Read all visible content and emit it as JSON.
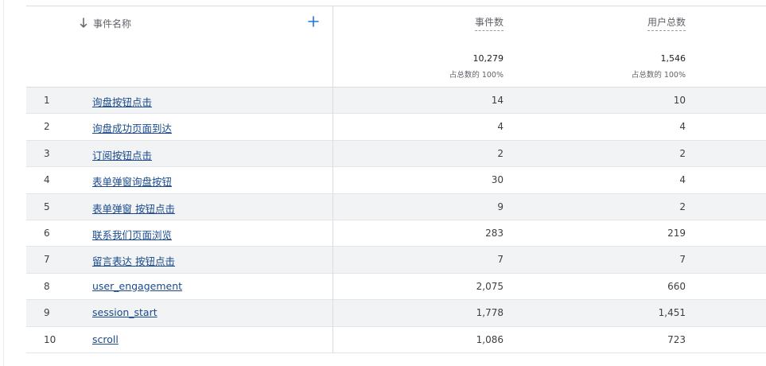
{
  "header": {
    "dimension_title": "事件名称",
    "metrics": [
      {
        "title": "事件数",
        "total": "10,279",
        "pct": "占总数的 100%"
      },
      {
        "title": "用户总数",
        "total": "1,546",
        "pct": "占总数的 100%"
      }
    ]
  },
  "icons": {
    "sort": "arrow-down-icon",
    "add": "plus-icon",
    "accent": "#1a73e8",
    "link": "#1a4a8c"
  },
  "rows": [
    {
      "index": "1",
      "name": "询盘按钮点击",
      "events": "14",
      "users": "10"
    },
    {
      "index": "2",
      "name": "询盘成功页面到达",
      "events": "4",
      "users": "4"
    },
    {
      "index": "3",
      "name": "订阅按钮点击",
      "events": "2",
      "users": "2"
    },
    {
      "index": "4",
      "name": "表单弹窗询盘按钮",
      "events": "30",
      "users": "4"
    },
    {
      "index": "5",
      "name": "表单弹窗 按钮点击",
      "events": "9",
      "users": "2"
    },
    {
      "index": "6",
      "name": "联系我们页面浏览",
      "events": "283",
      "users": "219"
    },
    {
      "index": "7",
      "name": "留言表达 按钮点击",
      "events": "7",
      "users": "7"
    },
    {
      "index": "8",
      "name": "user_engagement",
      "events": "2,075",
      "users": "660"
    },
    {
      "index": "9",
      "name": "session_start",
      "events": "1,778",
      "users": "1,451"
    },
    {
      "index": "10",
      "name": "scroll",
      "events": "1,086",
      "users": "723"
    }
  ]
}
